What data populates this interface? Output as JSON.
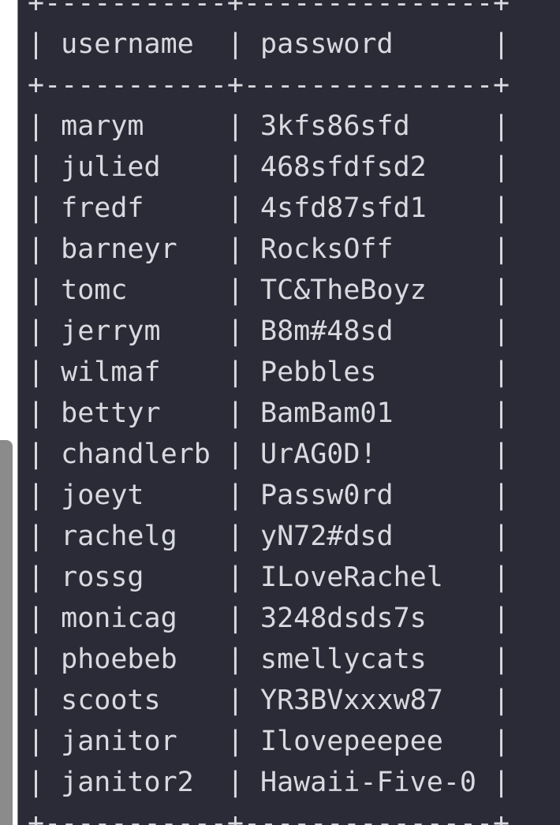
{
  "table": {
    "border_top": "+-----------+---------------+",
    "header_row": "| username  | password      |",
    "border_mid": "+-----------+---------------+",
    "rows": [
      "| marym     | 3kfs86sfd     |",
      "| julied    | 468sfdfsd2    |",
      "| fredf     | 4sfd87sfd1    |",
      "| barneyr   | RocksOff      |",
      "| tomc      | TC&TheBoyz    |",
      "| jerrym    | B8m#48sd      |",
      "| wilmaf    | Pebbles       |",
      "| bettyr    | BamBam01      |",
      "| chandlerb | UrAG0D!       |",
      "| joeyt     | Passw0rd      |",
      "| rachelg   | yN72#dsd      |",
      "| rossg     | ILoveRachel   |",
      "| monicag   | 3248dsds7s    |",
      "| phoebeb   | smellycats    |",
      "| scoots    | YR3BVxxxw87   |",
      "| janitor   | Ilovepeepee   |",
      "| janitor2  | Hawaii-Five-0 |"
    ],
    "border_bottom": "+-----------+---------------+"
  }
}
